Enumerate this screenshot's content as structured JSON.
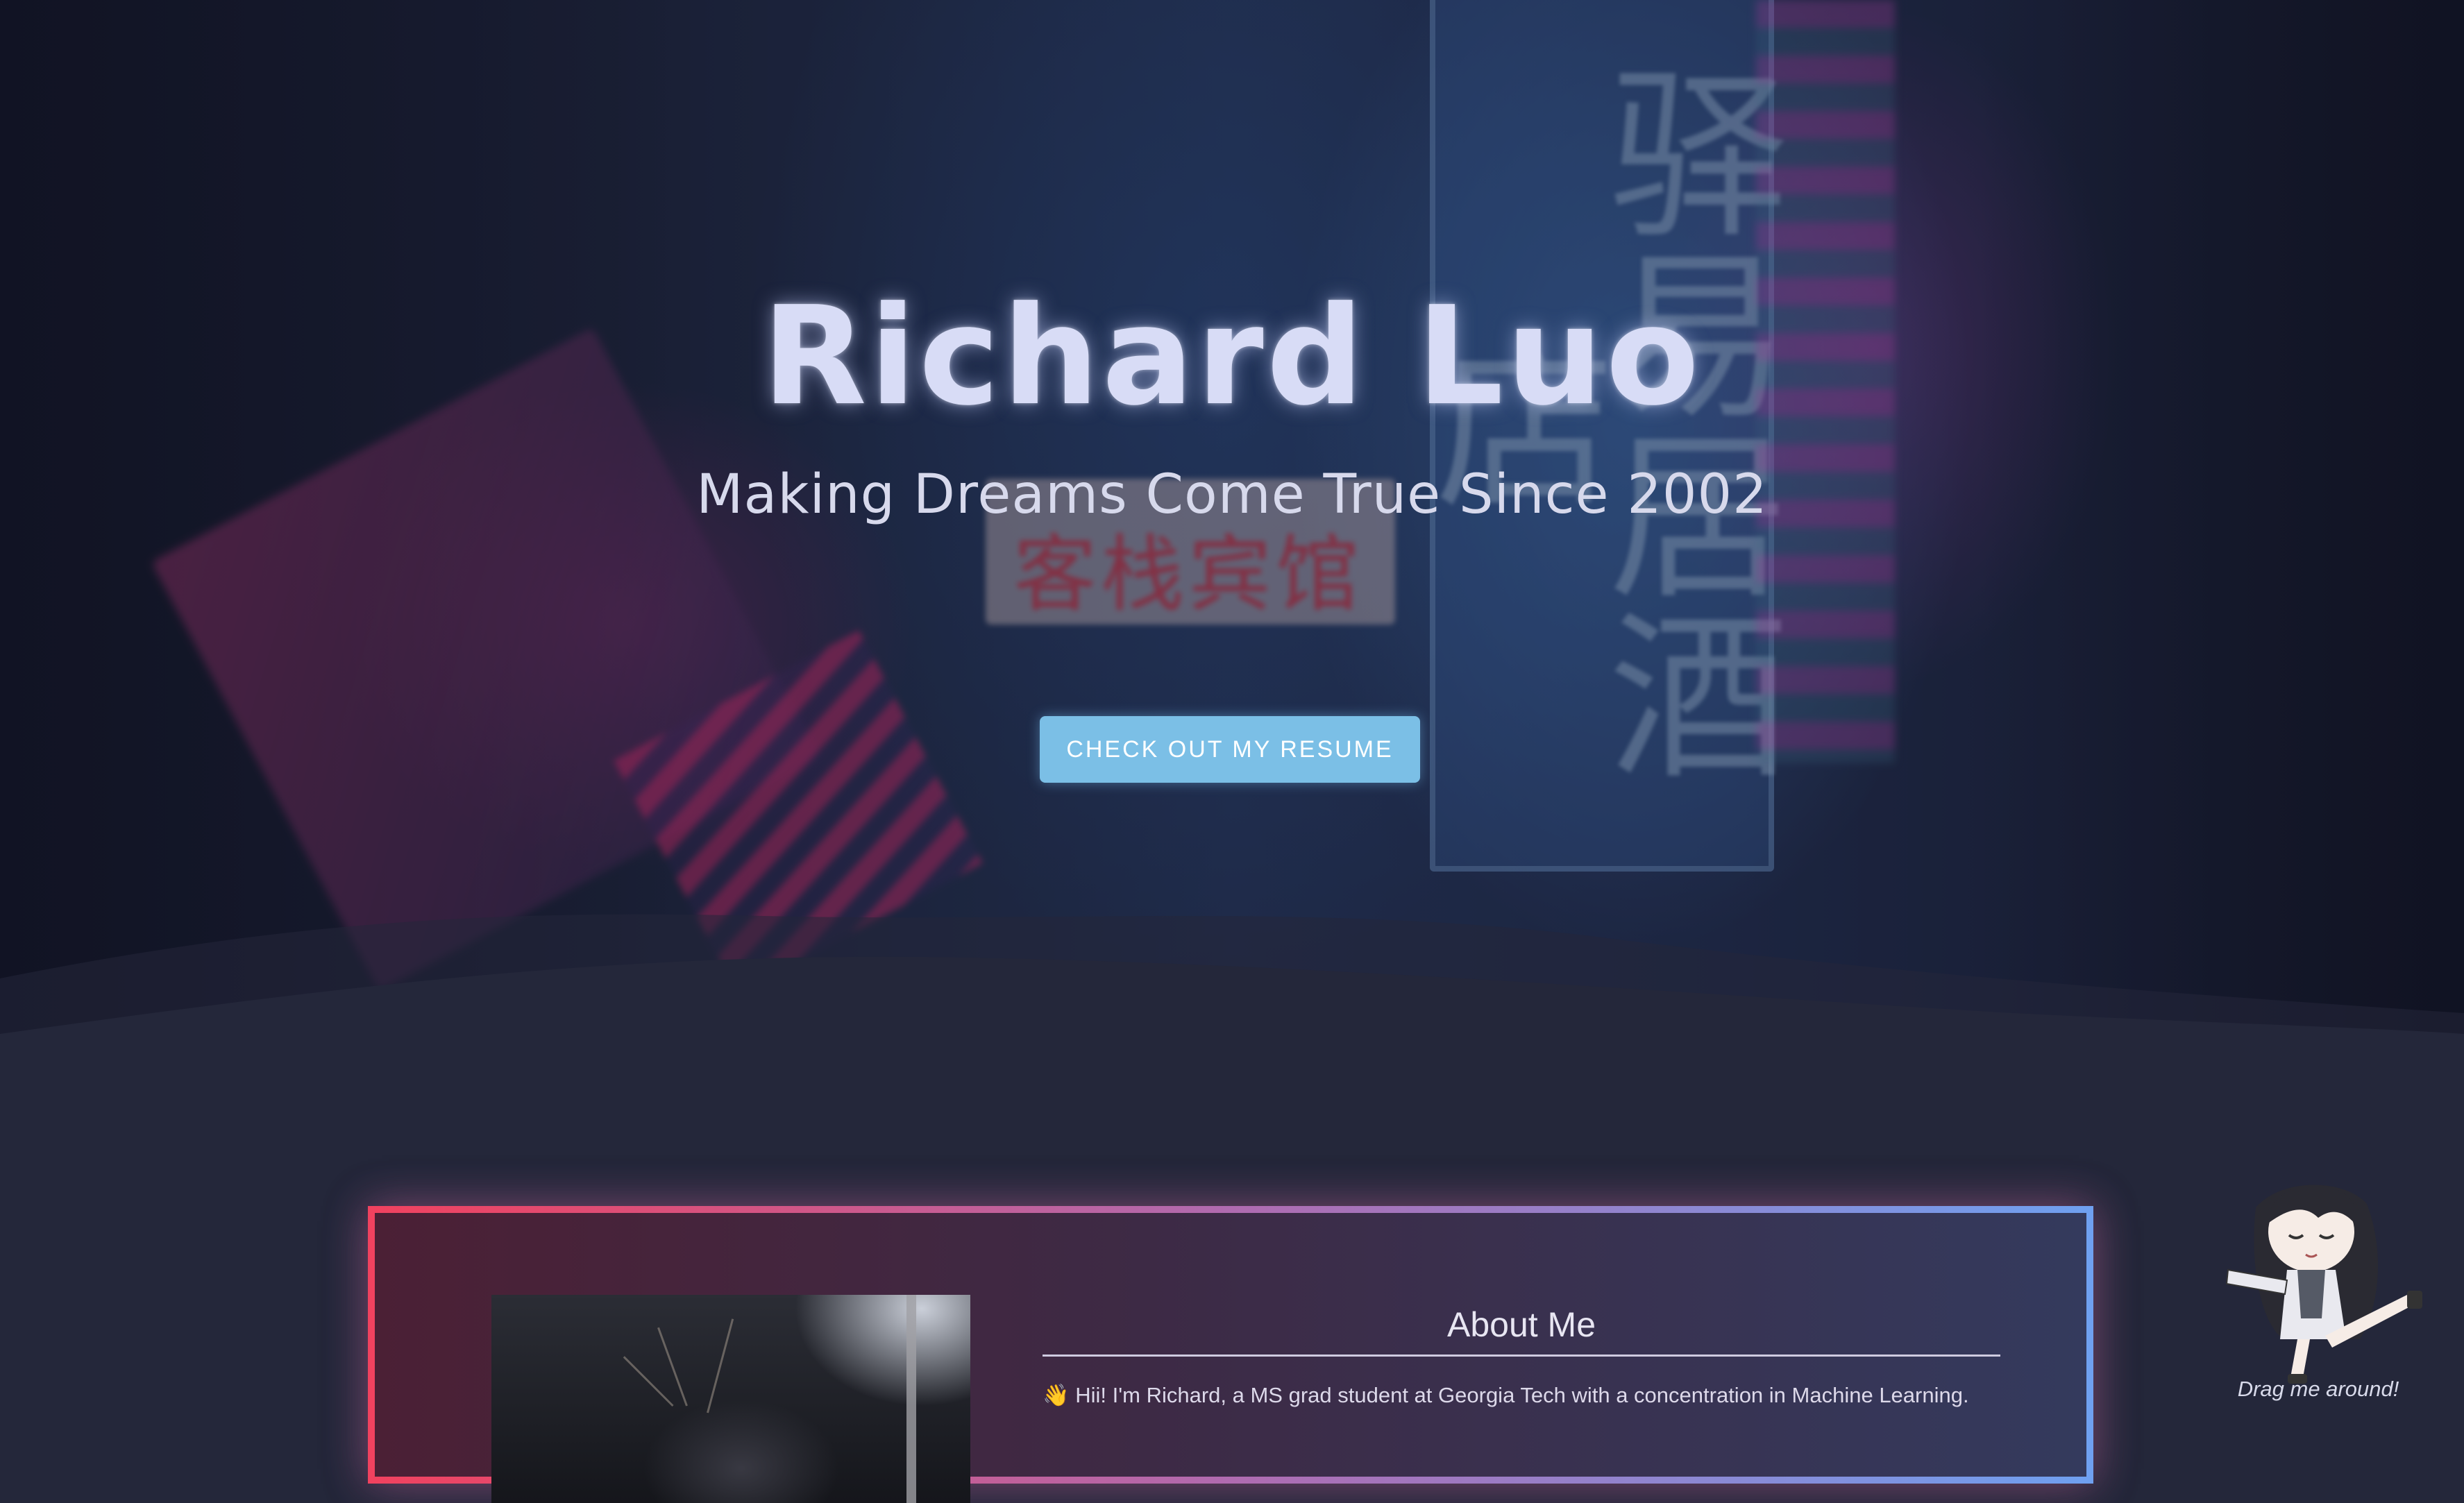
{
  "hero": {
    "title": "Richard Luo",
    "subtitle": "Making Dreams Come True Since 2002",
    "resume_button_label": "CHECK OUT MY RESUME",
    "background_sign_text": "驿易居酒店",
    "background_red_sign_text": "客栈宾馆"
  },
  "about": {
    "heading": "About Me",
    "intro_icon": "👋",
    "intro_text": "Hii! I'm Richard, a MS grad student at Georgia Tech with a concentration in Machine Learning."
  },
  "mascot": {
    "icon": "anime-girl-mascot-icon",
    "caption": "Drag me around!"
  },
  "colors": {
    "page_background": "#24273a",
    "button": "#7bbfe6",
    "card_border_left": "#f0425f",
    "card_border_right": "#6fa0f0"
  }
}
